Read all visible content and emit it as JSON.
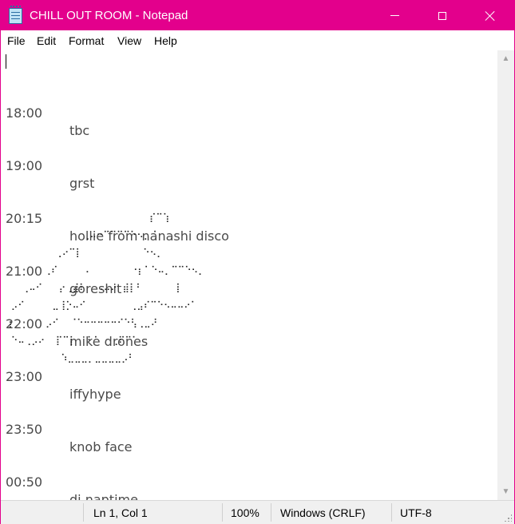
{
  "window": {
    "title": "CHILL OUT ROOM - Notepad",
    "accent_color": "#e3008c",
    "app_icon": "notepad-icon"
  },
  "menu": [
    "File",
    "Edit",
    "Format",
    "View",
    "Help"
  ],
  "schedule": [
    {
      "time": "18:00",
      "act": "tbc"
    },
    {
      "time": "19:00",
      "act": "grst"
    },
    {
      "time": "20:15",
      "act": "hollie from nanashi disco"
    },
    {
      "time": "21:00",
      "act": "goreshit"
    },
    {
      "time": "22:00",
      "act": "mike drones"
    },
    {
      "time": "23:00",
      "act": "iffyhype"
    },
    {
      "time": "23:50",
      "act": "knob face"
    },
    {
      "time": "00:50",
      "act": "dj naptime"
    }
  ],
  "ascii_art": "                          ⡎⠉⢱\n              ⢀⠤⠒⠉⠉⠉⠉⠑⠢⡀⠈\n         ⢀⠔⠉⡇           ⠑⠢⡀\n       ⢀⠎     ⠄       ⠐⡆⠁⠑⠤⡀⠉⠉⠑⠢⡀\n   ⢀⠤⠊   ⡔⢀⣼⠇  ⠠⠤⠔ ⣾⡇⠃      ⡇\n ⡠⠊     ⣀⢸⡑⠤⠊        ⢀⣠⠎⠉⠑⠢⠤⠤⠔⠁\n⢰      ⡠⠊  ⠈⠑⠒⠒⠒⠒⠒⠊⠑⢣⢀⣀⠜\n ⠑⠤⢀⡠⠔  ⡏⠉⡇  ⠃⠁  ⢀⠏⠉⠁\n          ⠱⣀⣀⣀⡀⣀⣀⣀⣀⡠⠃",
  "status": {
    "position": "Ln 1, Col 1",
    "zoom": "100%",
    "line_endings": "Windows (CRLF)",
    "encoding": "UTF-8"
  }
}
